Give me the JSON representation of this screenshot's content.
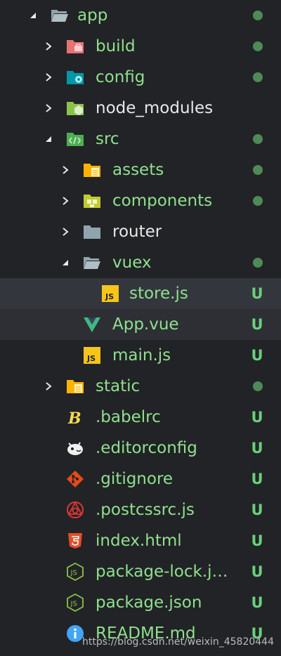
{
  "colors": {
    "background": "#222326",
    "selected_row": "#34363d",
    "untracked_green": "#69d07c",
    "modified_dot": "#4e8a57",
    "label_default": "#e8e8e8",
    "label_green": "#8fe08f"
  },
  "tree": [
    {
      "label": "app",
      "expanded": true,
      "icon": "folder-open-icon",
      "status": "dot"
    },
    {
      "label": "build",
      "expanded": false,
      "icon": "folder-build-icon",
      "status": "dot"
    },
    {
      "label": "config",
      "expanded": false,
      "icon": "folder-config-icon",
      "status": "dot"
    },
    {
      "label": "node_modules",
      "expanded": false,
      "icon": "folder-node-icon",
      "status": ""
    },
    {
      "label": "src",
      "expanded": true,
      "icon": "folder-src-icon",
      "status": "dot"
    },
    {
      "label": "assets",
      "expanded": false,
      "icon": "folder-assets-icon",
      "status": "dot"
    },
    {
      "label": "components",
      "expanded": false,
      "icon": "folder-components-icon",
      "status": "dot"
    },
    {
      "label": "router",
      "expanded": false,
      "icon": "folder-icon",
      "status": ""
    },
    {
      "label": "vuex",
      "expanded": true,
      "icon": "folder-open-icon",
      "status": "dot"
    },
    {
      "label": "store.js",
      "icon": "javascript-file-icon",
      "status": "U"
    },
    {
      "label": "App.vue",
      "icon": "vue-file-icon",
      "status": "U"
    },
    {
      "label": "main.js",
      "icon": "javascript-file-icon",
      "status": "U"
    },
    {
      "label": "static",
      "expanded": false,
      "icon": "folder-static-icon",
      "status": "dot"
    },
    {
      "label": ".babelrc",
      "icon": "babel-icon",
      "status": "U"
    },
    {
      "label": ".editorconfig",
      "icon": "editorconfig-icon",
      "status": "U"
    },
    {
      "label": ".gitignore",
      "icon": "git-icon",
      "status": "U"
    },
    {
      "label": ".postcssrc.js",
      "icon": "postcss-icon",
      "status": "U"
    },
    {
      "label": "index.html",
      "icon": "html5-icon",
      "status": "U"
    },
    {
      "label": "package-lock.j…",
      "icon": "nodejs-icon",
      "status": "U"
    },
    {
      "label": "package.json",
      "icon": "nodejs-icon",
      "status": "U"
    },
    {
      "label": "README.md",
      "icon": "info-icon",
      "status": "U"
    }
  ],
  "watermark": "https://blog.csdn.net/weixin_45820444"
}
